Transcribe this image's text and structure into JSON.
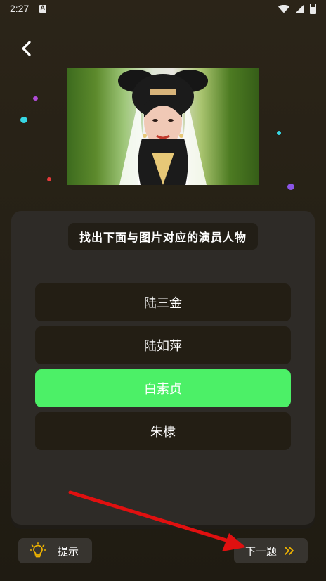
{
  "status_bar": {
    "time": "2:27"
  },
  "question": {
    "text": "找出下面与图片对应的演员人物"
  },
  "options": [
    {
      "label": "陆三金",
      "selected": false
    },
    {
      "label": "陆如萍",
      "selected": false
    },
    {
      "label": "白素贞",
      "selected": true
    },
    {
      "label": "朱棣",
      "selected": false
    }
  ],
  "hint_button": {
    "label": "提示"
  },
  "next_button": {
    "label": "下一题"
  },
  "colors": {
    "selected_option": "#4cf067",
    "hint_icon": "#f0b400",
    "next_icon": "#f0b400",
    "annotation_arrow": "#e01010"
  }
}
